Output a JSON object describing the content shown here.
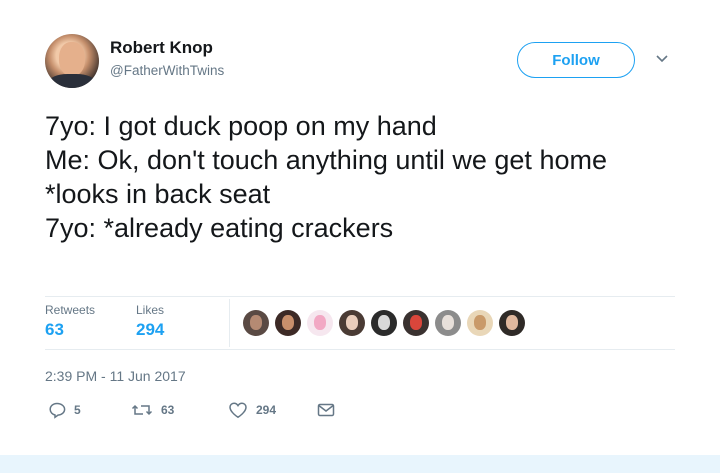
{
  "user": {
    "name": "Robert Knop",
    "handle": "@FatherWithTwins"
  },
  "follow_button": {
    "label": "Follow"
  },
  "tweet": {
    "text": "7yo: I got duck poop on my hand\nMe: Ok, don't touch anything until we get home\n*looks in back seat\n7yo: *already eating crackers",
    "timestamp": "2:39 PM - 11 Jun 2017"
  },
  "stats": {
    "retweets_label": "Retweets",
    "retweets_value": "63",
    "likes_label": "Likes",
    "likes_value": "294"
  },
  "actions": {
    "reply_count": "5",
    "retweet_count": "63",
    "like_count": "294"
  },
  "colors": {
    "accent": "#1da1f2",
    "secondary_text": "#657786",
    "footer": "#e8f5fd"
  },
  "likers": [
    {
      "name": "liker-1",
      "bg": "#5a4a44",
      "fg": "#b58a73"
    },
    {
      "name": "liker-2",
      "bg": "#3d2a26",
      "fg": "#c98f6b"
    },
    {
      "name": "liker-3",
      "bg": "#f6e7ef",
      "fg": "#f2a8c4"
    },
    {
      "name": "liker-4",
      "bg": "#4a3b34",
      "fg": "#e9cdbb"
    },
    {
      "name": "liker-5",
      "bg": "#2b2b2b",
      "fg": "#d8d8d8"
    },
    {
      "name": "liker-6",
      "bg": "#3a3230",
      "fg": "#d9463b"
    },
    {
      "name": "liker-7",
      "bg": "#8c8c8c",
      "fg": "#e8e0da"
    },
    {
      "name": "liker-8",
      "bg": "#e9d7b8",
      "fg": "#c99a6a"
    },
    {
      "name": "liker-9",
      "bg": "#2f2a27",
      "fg": "#e0b89e"
    }
  ]
}
